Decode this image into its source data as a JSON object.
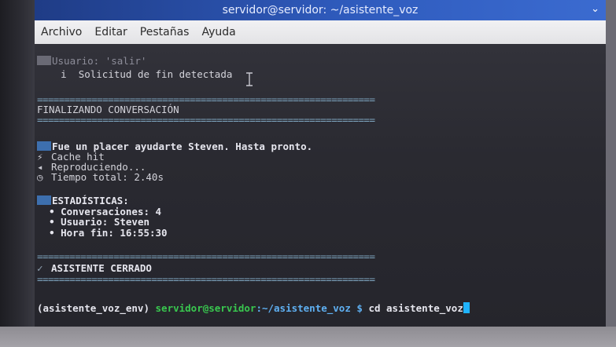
{
  "window": {
    "title": "servidor@servidor: ~/asistente_voz"
  },
  "menu": [
    "Archivo",
    "Editar",
    "Pestañas",
    "Ayuda"
  ],
  "terminal": {
    "user_input": "Usuario: 'salir'",
    "end_request": "Solicitud de fin detectada",
    "separator": "==============================================================",
    "finalizing": "FINALIZANDO CONVERSACIÓN",
    "goodbye": "Fue un placer ayudarte Steven. Hasta pronto.",
    "cache": "Cache hit",
    "playing": "Reproduciendo...",
    "total_time": "Tiempo total: 2.40s",
    "stats_header": "ESTADÍSTICAS:",
    "stat_conversations": "• Conversaciones: 4",
    "stat_user": "• Usuario: Steven",
    "stat_end_time": "• Hora fin: 16:55:30",
    "closed": "ASISTENTE CERRADO",
    "prompt_env": "(asistente_voz_env) ",
    "prompt_user_host": "servidor@servidor",
    "prompt_path": ":~/asistente_voz $ ",
    "command": "cd asistente_voz"
  },
  "colors": {
    "titlebar": "#2f5bbd",
    "prompt_user_host": "#39c84f",
    "prompt_path": "#5fb0f2",
    "cursor": "#1fb3ff",
    "emoji_box": "#3d6fae"
  },
  "icons": [
    "emoji-box-icon",
    "info-icon",
    "chat-emoji-icon",
    "lightning-icon",
    "speaker-icon",
    "clock-icon",
    "stats-emoji-icon",
    "check-icon",
    "chevron-down-icon",
    "text-cursor-icon"
  ]
}
